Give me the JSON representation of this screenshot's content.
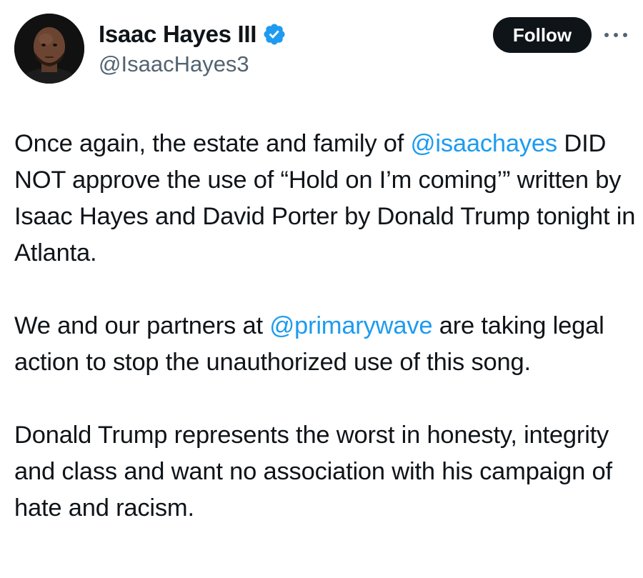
{
  "author": {
    "display_name": "Isaac Hayes III",
    "handle": "@IsaacHayes3",
    "verified_icon": "verified-badge-icon",
    "verified_color": "#1d9bf0"
  },
  "actions": {
    "follow_label": "Follow",
    "more_icon": "more-options-icon"
  },
  "tweet": {
    "p1_before": "Once again, the estate and family of ",
    "p1_mention": "@isaachayes",
    "p1_after": " DID NOT approve the use of “Hold on I’m coming’” written by Isaac Hayes and David Porter by Donald Trump tonight in Atlanta.",
    "p2_before": "We and our partners at ",
    "p2_mention": "@primarywave",
    "p2_after": " are taking legal action to stop the unauthorized use of this song.",
    "p3": "Donald Trump represents the worst in honesty, integrity and class and want no association with his campaign of hate and racism."
  },
  "colors": {
    "text": "#0f1419",
    "secondary": "#536471",
    "link": "#1d9bf0",
    "follow_bg": "#0f1419"
  }
}
